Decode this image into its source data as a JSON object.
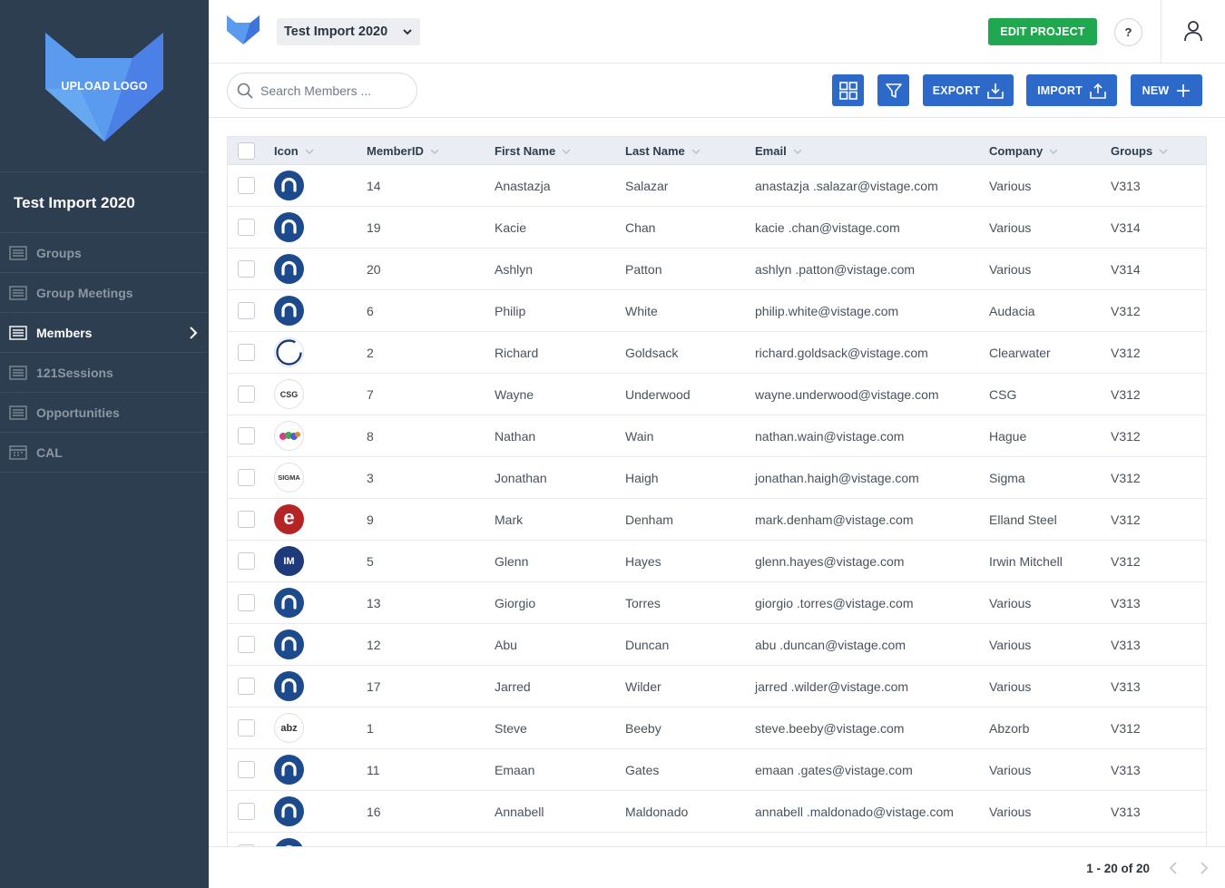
{
  "sidebar": {
    "logo_label": "UPLOAD LOGO",
    "project_title": "Test Import 2020",
    "items": [
      {
        "label": "Groups",
        "icon": "list-icon",
        "active": false
      },
      {
        "label": "Group Meetings",
        "icon": "list-icon",
        "active": false
      },
      {
        "label": "Members",
        "icon": "list-icon",
        "active": true
      },
      {
        "label": "121Sessions",
        "icon": "list-icon",
        "active": false
      },
      {
        "label": "Opportunities",
        "icon": "list-icon",
        "active": false
      },
      {
        "label": "CAL",
        "icon": "calendar-icon",
        "active": false
      }
    ]
  },
  "header": {
    "project_name": "Test Import 2020",
    "edit_label": "EDIT PROJECT",
    "help_label": "?"
  },
  "toolbar": {
    "search_placeholder": "Search Members ...",
    "export_label": "EXPORT",
    "import_label": "IMPORT",
    "new_label": "NEW"
  },
  "table": {
    "columns": [
      "Icon",
      "MemberID",
      "First Name",
      "Last Name",
      "Email",
      "Company",
      "Groups"
    ],
    "rows": [
      {
        "icon": "a-logo",
        "id": "14",
        "first": "Anastazja",
        "last": "Salazar",
        "email": "anastazja .salazar@vistage.com",
        "company": "Various",
        "group": "V313"
      },
      {
        "icon": "a-logo",
        "id": "19",
        "first": "Kacie",
        "last": "Chan",
        "email": "kacie .chan@vistage.com",
        "company": "Various",
        "group": "V314"
      },
      {
        "icon": "a-logo",
        "id": "20",
        "first": "Ashlyn",
        "last": "Patton",
        "email": "ashlyn .patton@vistage.com",
        "company": "Various",
        "group": "V314"
      },
      {
        "icon": "a-logo",
        "id": "6",
        "first": "Philip",
        "last": "White",
        "email": "philip.white@vistage.com",
        "company": "Audacia",
        "group": "V312"
      },
      {
        "icon": "ring-logo",
        "id": "2",
        "first": "Richard",
        "last": "Goldsack",
        "email": "richard.goldsack@vistage.com",
        "company": "Clearwater",
        "group": "V312"
      },
      {
        "icon": "csg-logo",
        "icon_text": "CSG",
        "id": "7",
        "first": "Wayne",
        "last": "Underwood",
        "email": "wayne.underwood@vistage.com",
        "company": "CSG",
        "group": "V312"
      },
      {
        "icon": "hague-logo",
        "id": "8",
        "first": "Nathan",
        "last": "Wain",
        "email": "nathan.wain@vistage.com",
        "company": "Hague",
        "group": "V312"
      },
      {
        "icon": "sigma-logo",
        "icon_text": "SIGMA",
        "id": "3",
        "first": "Jonathan",
        "last": "Haigh",
        "email": "jonathan.haigh@vistage.com",
        "company": "Sigma",
        "group": "V312"
      },
      {
        "icon": "e-logo",
        "icon_text": "e",
        "id": "9",
        "first": "Mark",
        "last": "Denham",
        "email": "mark.denham@vistage.com",
        "company": "Elland Steel",
        "group": "V312"
      },
      {
        "icon": "im-logo",
        "icon_text": "IM",
        "id": "5",
        "first": "Glenn",
        "last": "Hayes",
        "email": "glenn.hayes@vistage.com",
        "company": "Irwin Mitchell",
        "group": "V312"
      },
      {
        "icon": "a-logo",
        "id": "13",
        "first": "Giorgio",
        "last": "Torres",
        "email": "giorgio .torres@vistage.com",
        "company": "Various",
        "group": "V313"
      },
      {
        "icon": "a-logo",
        "id": "12",
        "first": "Abu",
        "last": "Duncan",
        "email": "abu .duncan@vistage.com",
        "company": "Various",
        "group": "V313"
      },
      {
        "icon": "a-logo",
        "id": "17",
        "first": "Jarred",
        "last": "Wilder",
        "email": "jarred .wilder@vistage.com",
        "company": "Various",
        "group": "V313"
      },
      {
        "icon": "abz-logo",
        "icon_text": "abz",
        "id": "1",
        "first": "Steve",
        "last": "Beeby",
        "email": "steve.beeby@vistage.com",
        "company": "Abzorb",
        "group": "V312"
      },
      {
        "icon": "a-logo",
        "id": "11",
        "first": "Emaan",
        "last": "Gates",
        "email": "emaan .gates@vistage.com",
        "company": "Various",
        "group": "V313"
      },
      {
        "icon": "a-logo",
        "id": "16",
        "first": "Annabell",
        "last": "Maldonado",
        "email": "annabell .maldonado@vistage.com",
        "company": "Various",
        "group": "V313"
      },
      {
        "icon": "a-logo",
        "id": "",
        "first": "",
        "last": "",
        "email": "",
        "company": "",
        "group": ""
      }
    ]
  },
  "pagination": {
    "range_text": "1 - 20 of 20"
  },
  "colors": {
    "sidebar_bg": "#2c3e50",
    "primary": "#2c69c9",
    "success": "#1fa84f",
    "table_header_bg": "#eaeef4"
  }
}
